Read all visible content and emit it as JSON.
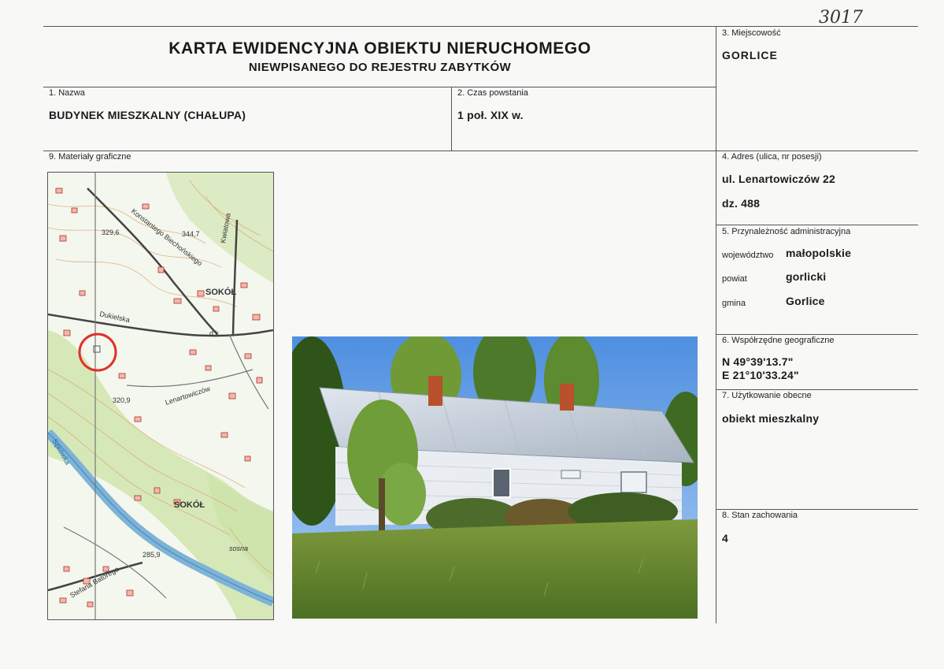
{
  "handwritten_number": "3017",
  "header": {
    "title": "KARTA EWIDENCYJNA OBIEKTU NIERUCHOMEGO",
    "subtitle": "NIEWPISANEGO DO REJESTRU ZABYTKÓW"
  },
  "fields": {
    "name": {
      "label": "1. Nazwa",
      "value": "BUDYNEK MIESZKALNY (CHAŁUPA)"
    },
    "time": {
      "label": "2. Czas powstania",
      "value": "1 poł. XIX w."
    },
    "locality": {
      "label": "3. Miejscowość",
      "value": "GORLICE"
    },
    "address": {
      "label": "4. Adres (ulica, nr posesji)",
      "line1": "ul. Lenartowiczów 22",
      "line2": "dz. 488"
    },
    "admin": {
      "label": "5. Przynależność administracyjna",
      "voivodeship_label": "województwo",
      "voivodeship": "małopolskie",
      "county_label": "powiat",
      "county": "gorlicki",
      "commune_label": "gmina",
      "commune": "Gorlice"
    },
    "coords": {
      "label": "6. Współrzędne geograficzne",
      "lat": "N 49°39'13.7\"",
      "lon": "E 21°10'33.24\""
    },
    "usage": {
      "label": "7. Użytkowanie obecne",
      "value": "obiekt mieszkalny"
    },
    "condition": {
      "label": "8. Stan zachowania",
      "value": "4"
    },
    "graphics": {
      "label": "9. Materiały graficzne"
    }
  },
  "map": {
    "labels": {
      "elev1": "329,6",
      "elev2": "344,7",
      "elev3": "320,9",
      "elev4": "285,9",
      "street1": "Konstantego Biechońskiego",
      "street2": "Kwiatowa",
      "street3": "Dukielska",
      "street4": "Lenartowiczów",
      "street5": "Stefana Batorego",
      "river": "Sękówka",
      "place1": "SOKÓŁ",
      "place2": "SOKÓŁ",
      "other": "sosna",
      "other2": "d.k."
    }
  }
}
